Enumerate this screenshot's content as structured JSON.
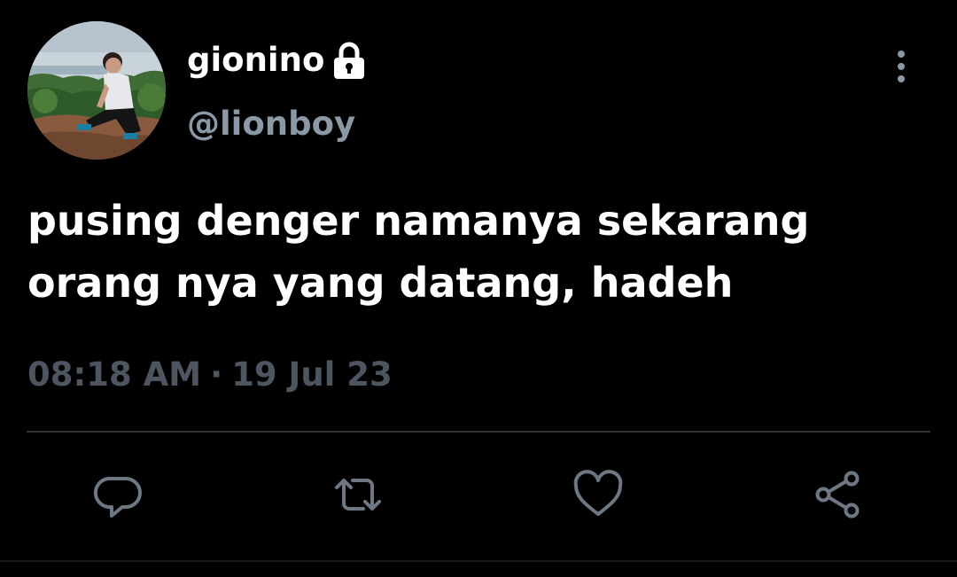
{
  "user": {
    "display_name": "gionino",
    "handle": "@lionboy",
    "avatar_icon": "avatar-photo",
    "protected_icon": "lock-icon"
  },
  "tweet": {
    "text": "pusing denger namanya sekarang\norang nya yang datang, hadeh",
    "time": "08:18 AM",
    "separator": "·",
    "date": "19 Jul 23"
  },
  "actions": {
    "reply_icon": "reply-icon",
    "retweet_icon": "retweet-icon",
    "like_icon": "heart-icon",
    "share_icon": "share-icon",
    "more_icon": "more-vertical-icon"
  },
  "colors": {
    "background": "#000000",
    "text_primary": "#ffffff",
    "text_secondary": "#8b98a5",
    "timestamp": "#4d5660",
    "icon": "#6e7882",
    "divider": "#2f3336"
  }
}
